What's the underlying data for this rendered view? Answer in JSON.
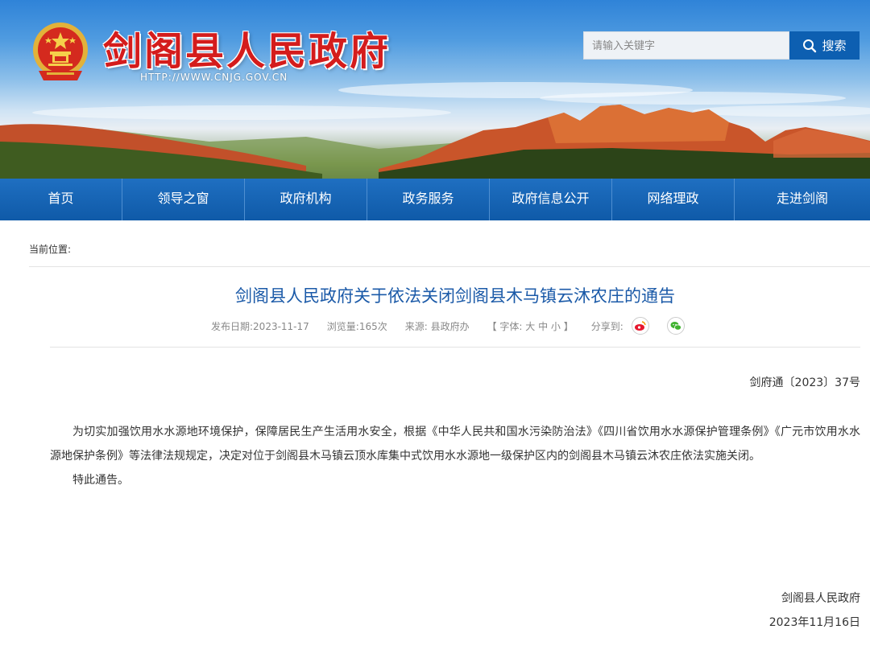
{
  "header": {
    "site_title": "剑阁县人民政府",
    "site_url": "HTTP://WWW.CNJG.GOV.CN",
    "search_placeholder": "请输入关键字",
    "search_button_label": "搜索"
  },
  "nav": {
    "items": [
      "首页",
      "领导之窗",
      "政府机构",
      "政务服务",
      "政府信息公开",
      "网络理政",
      "走进剑阁"
    ]
  },
  "breadcrumb": {
    "label": "当前位置:"
  },
  "article": {
    "title": "剑阁县人民政府关于依法关闭剑阁县木马镇云沐农庄的通告",
    "meta": {
      "publish_date": "发布日期:2023-11-17",
      "views": "浏览量:165次",
      "source": "来源:  县政府办",
      "font_size": "【 字体:  大  中  小 】",
      "share_label": "分享到:"
    },
    "doc_number": "剑府通〔2023〕37号",
    "paragraphs": [
      "为切实加强饮用水水源地环境保护，保障居民生产生活用水安全，根据《中华人民共和国水污染防治法》《四川省饮用水水源保护管理条例》《广元市饮用水水源地保护条例》等法律法规规定，决定对位于剑阁县木马镇云顶水库集中式饮用水水源地一级保护区内的剑阁县木马镇云沐农庄依法实施关闭。",
      "特此通告。"
    ],
    "signer": "剑阁县人民政府",
    "sign_date": "2023年11月16日"
  },
  "icons": {
    "emblem": "national-emblem-icon",
    "search": "search-icon",
    "share_weibo": "weibo-icon",
    "share_wechat": "wechat-icon"
  },
  "colors": {
    "title_red": "#d41c1c",
    "nav_blue": "#0f5aa8",
    "search_button_blue": "#0d5fb1",
    "article_title_blue": "#1b5aa8",
    "weibo": "#e6162d",
    "wechat": "#3fb22f"
  }
}
